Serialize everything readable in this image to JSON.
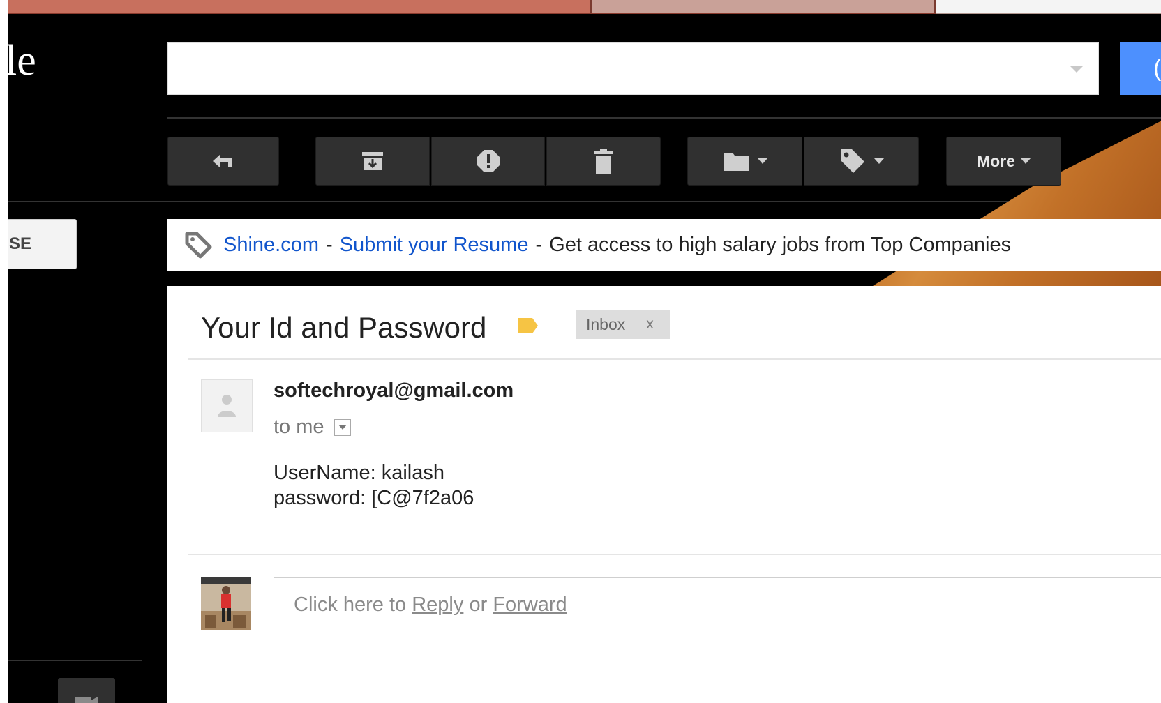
{
  "app": {
    "logo_fragment": "le"
  },
  "search": {
    "value": "",
    "button_fragment": "("
  },
  "toolbar": {
    "buttons": [
      {
        "icon": "reply-icon"
      },
      {
        "icon": "archive-icon"
      },
      {
        "icon": "report-spam-icon"
      },
      {
        "icon": "delete-icon"
      },
      {
        "icon": "move-to-folder-icon"
      },
      {
        "icon": "labels-icon"
      }
    ],
    "more_label": "More"
  },
  "sidebar": {
    "compose_fragment": "SE"
  },
  "ad": {
    "advertiser": "Shine.com",
    "separator1": "-",
    "headline": "Submit your Resume",
    "separator2": "-",
    "text": "Get access to high salary jobs from Top Companies"
  },
  "message": {
    "subject": "Your Id and Password",
    "label_color": "#f6c444",
    "inbox_chip": "Inbox",
    "inbox_remove": "x",
    "sender": "softechroyal@gmail.com",
    "recipient": "to me",
    "body": {
      "line1": "UserName: kailash",
      "line2": "password: [C@7f2a06"
    }
  },
  "reply": {
    "prefix": "Click here to",
    "reply_link": "Reply",
    "or": "or",
    "forward_link": "Forward"
  },
  "colors": {
    "accent_blue": "#4d90fe",
    "link": "#1155cc",
    "background": "#000000"
  }
}
